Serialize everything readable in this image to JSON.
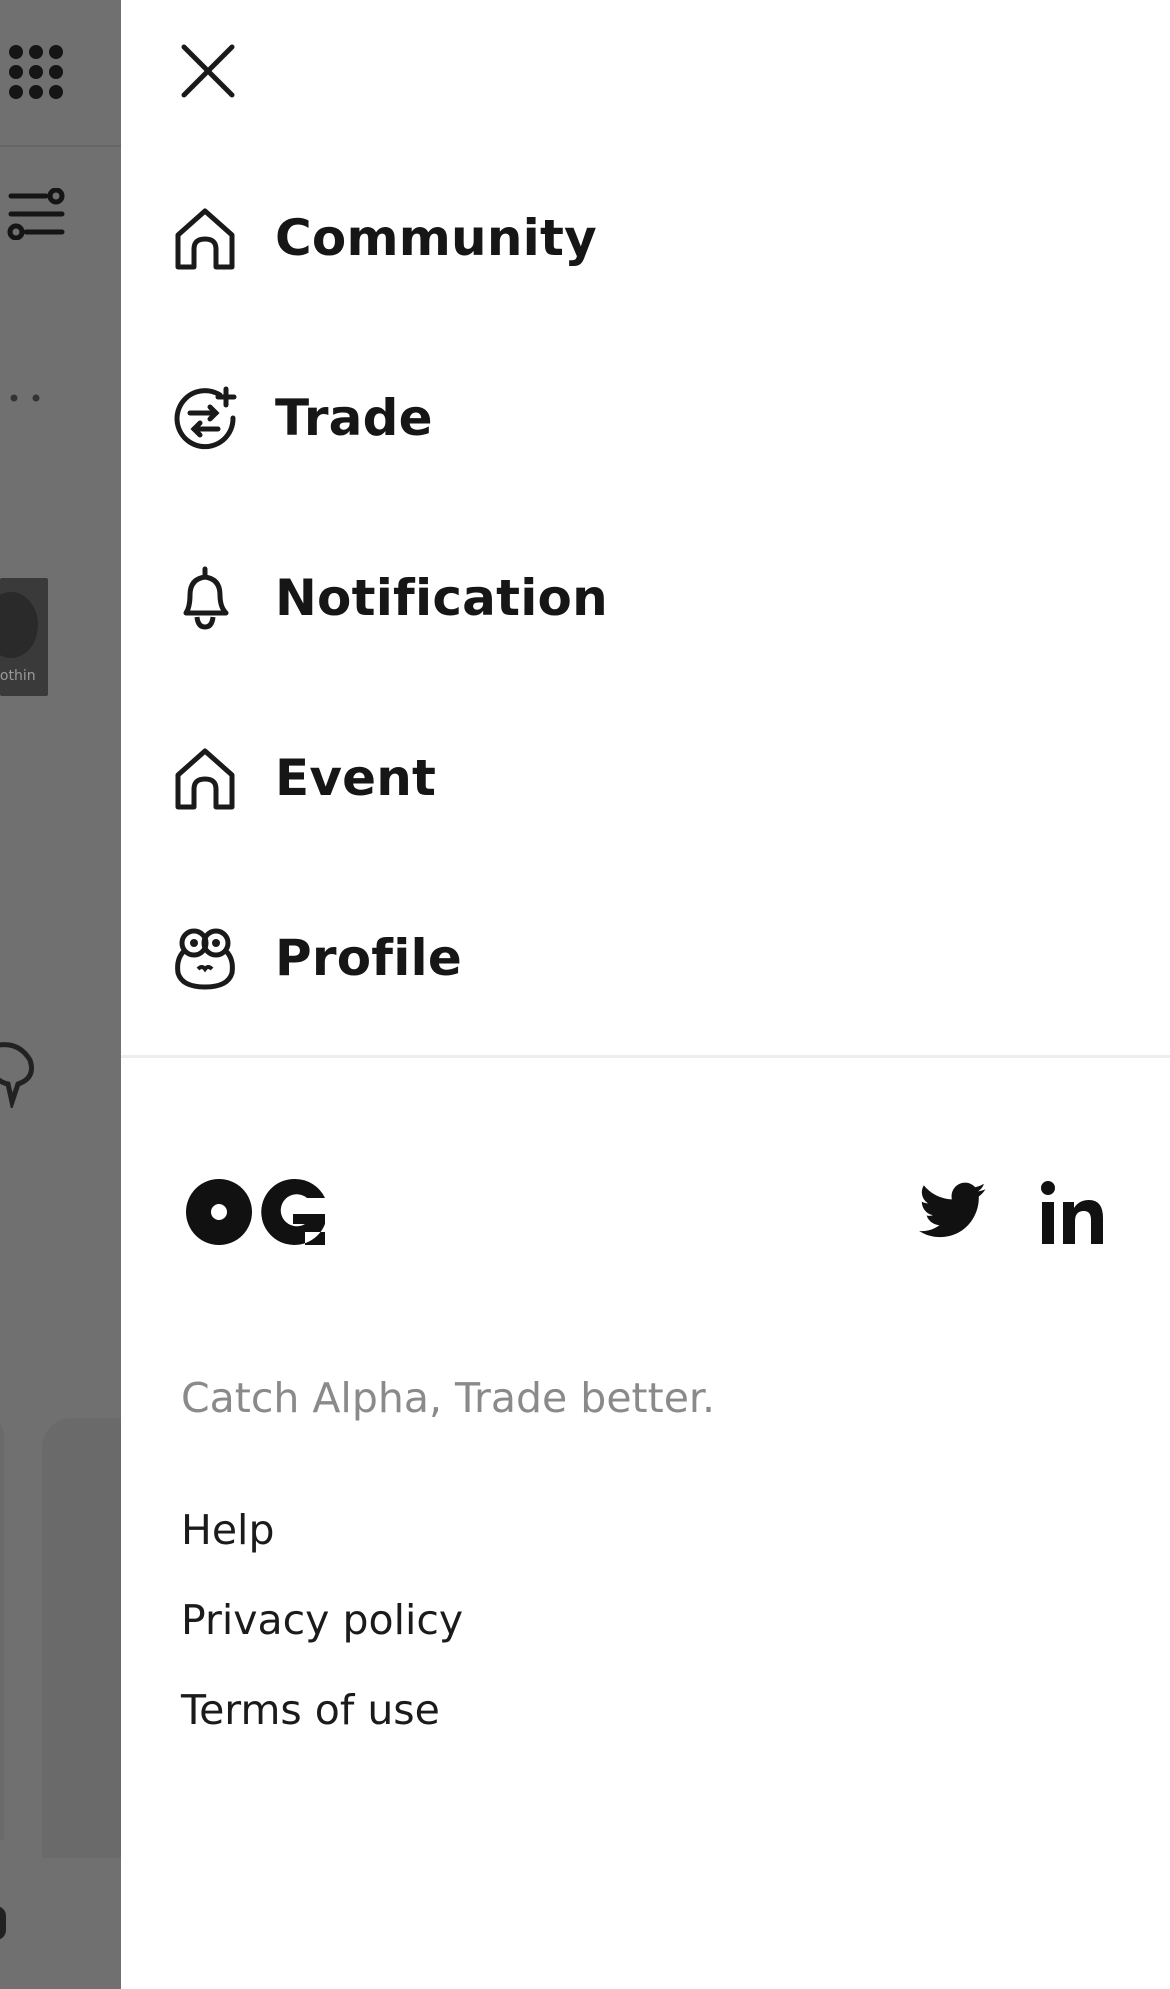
{
  "drawer": {
    "nav": [
      {
        "label": "Community",
        "icon": "home-icon"
      },
      {
        "label": "Trade",
        "icon": "trade-exchange-icon"
      },
      {
        "label": "Notification",
        "icon": "bell-icon"
      },
      {
        "label": "Event",
        "icon": "home-icon"
      },
      {
        "label": "Profile",
        "icon": "frog-avatar-icon"
      }
    ],
    "tagline": "Catch Alpha, Trade better.",
    "footer_links": [
      "Help",
      "Privacy policy",
      "Terms of use"
    ],
    "social": [
      "twitter-icon",
      "linkedin-icon"
    ],
    "logo_text": "OG"
  },
  "background": {
    "thumbnail_caption": "lothin"
  },
  "colors": {
    "text": "#161616",
    "muted": "#8a8a8a",
    "overlay": "#707070",
    "divider": "#eceef0"
  }
}
